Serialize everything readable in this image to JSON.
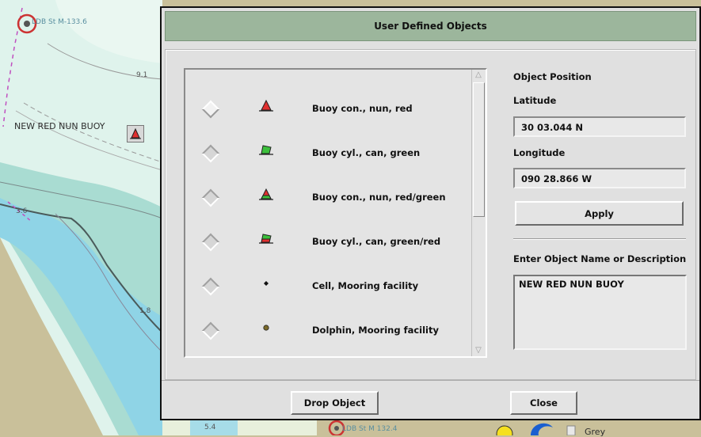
{
  "map": {
    "top_marker_label": "LDB St M-133.6",
    "bottom_marker_label": "LDB St M 132.4",
    "depth_labels": [
      "9.1",
      "3.6",
      "1.8",
      "5.4"
    ],
    "placed_buoy_label": "NEW RED NUN BUOY",
    "bottom_right_text": "Grey"
  },
  "dialog": {
    "title": "User Defined Objects",
    "objects": [
      {
        "label": "Buoy con., nun, red",
        "icon": "nun-red-buoy-icon",
        "selected": true
      },
      {
        "label": "Buoy cyl., can, green",
        "icon": "can-green-buoy-icon",
        "selected": false
      },
      {
        "label": "Buoy con., nun, red/green",
        "icon": "nun-red-green-buoy-icon",
        "selected": false
      },
      {
        "label": "Buoy cyl., can, green/red",
        "icon": "can-green-red-buoy-icon",
        "selected": false
      },
      {
        "label": "Cell, Mooring facility",
        "icon": "cell-mooring-icon",
        "selected": false
      },
      {
        "label": "Dolphin, Mooring facility",
        "icon": "dolphin-mooring-icon",
        "selected": false
      }
    ],
    "position": {
      "heading": "Object Position",
      "latitude_label": "Latitude",
      "latitude_value": "30 03.044 N",
      "longitude_label": "Longitude",
      "longitude_value": "090 28.866 W",
      "apply_label": "Apply"
    },
    "description": {
      "label": "Enter Object Name or Description",
      "value": "NEW RED NUN BUOY"
    },
    "drop_label": "Drop Object",
    "close_label": "Close"
  },
  "colors": {
    "titlebar": "#9cb69c",
    "buoy_red": "#e03030",
    "buoy_green": "#3cc03c",
    "dolphin": "#7a6a2a"
  }
}
